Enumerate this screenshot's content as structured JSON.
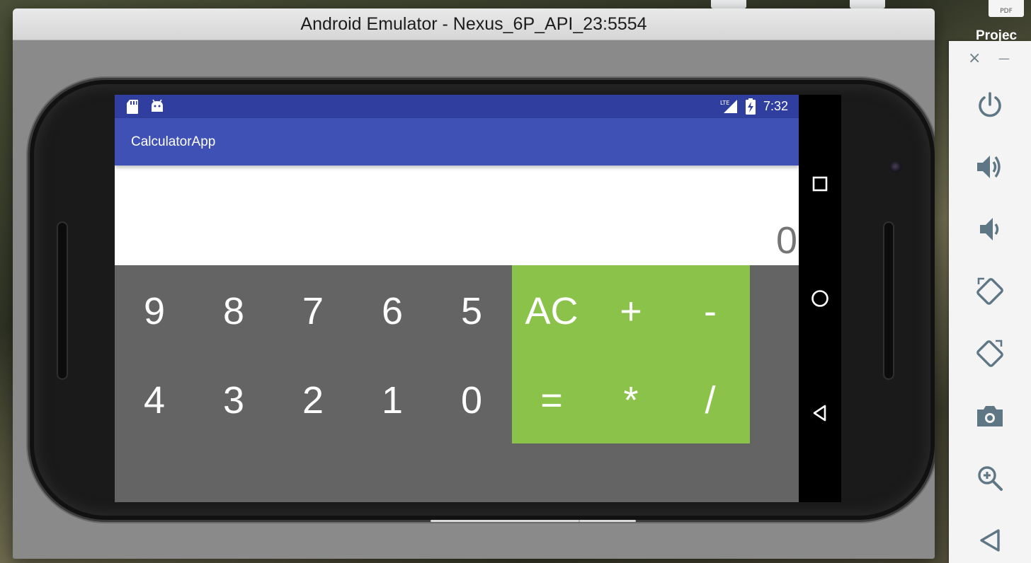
{
  "desktop": {
    "pdf_icon_label": "PDF",
    "project_label": "Projec"
  },
  "window": {
    "title": "Android Emulator - Nexus_6P_API_23:5554"
  },
  "status_bar": {
    "icons": [
      "sd-card-icon",
      "android-debug-icon",
      "lte-signal-icon",
      "battery-charging-icon"
    ],
    "lte_text": "LTE",
    "time": "7:32",
    "color": "#303f9f"
  },
  "app_bar": {
    "title": "CalculatorApp",
    "color": "#3f51b5"
  },
  "display": {
    "value": "0"
  },
  "keypad": {
    "digits_row1": [
      "9",
      "8",
      "7",
      "6",
      "5"
    ],
    "digits_row2": [
      "4",
      "3",
      "2",
      "1",
      "0"
    ],
    "ops_row1": [
      "AC",
      "+",
      "-"
    ],
    "ops_row2": [
      "=",
      "*",
      "/"
    ],
    "op_color": "#8bc34a",
    "keypad_color": "#646464"
  },
  "nav_bar": {
    "buttons": [
      "recents-icon",
      "home-icon",
      "back-icon"
    ]
  },
  "toolbar": {
    "close_glyph": "×",
    "minimize_glyph": "—",
    "buttons": [
      "power-icon",
      "volume-up-icon",
      "volume-down-icon",
      "rotate-left-icon",
      "rotate-right-icon",
      "screenshot-icon",
      "zoom-icon",
      "back-icon"
    ]
  }
}
